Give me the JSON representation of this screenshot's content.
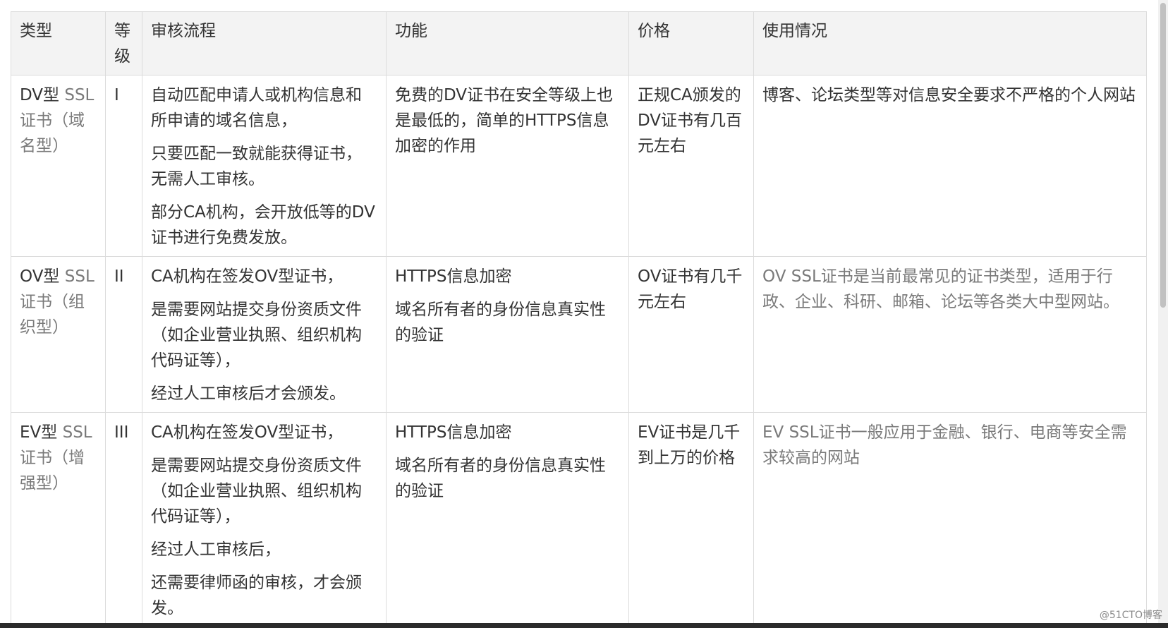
{
  "table": {
    "headers": [
      "类型",
      "等级",
      "审核流程",
      "功能",
      "价格",
      "使用情况"
    ],
    "rows": [
      {
        "type_main": "DV型",
        "type_rest": " SSL证书（域名型）",
        "level": "I",
        "process": [
          "自动匹配申请人或机构信息和所申请的域名信息，",
          "只要匹配一致就能获得证书，无需人工审核。",
          "部分CA机构，会开放低等的DV证书进行免费发放。"
        ],
        "function": [
          "免费的DV证书在安全等级上也是最低的，简单的HTTPS信息加密的作用"
        ],
        "price": "正规CA颁发的DV证书有几百元左右",
        "usage_main": "博客、论坛类型等对信息安全要求不严格的个人网站",
        "usage_rest": ""
      },
      {
        "type_main": "OV型",
        "type_rest": " SSL证书（组织型）",
        "level": "II",
        "process": [
          "CA机构在签发OV型证书，",
          "是需要网站提交身份资质文件（如企业营业执照、组织机构代码证等），",
          "经过人工审核后才会颁发。"
        ],
        "function": [
          "HTTPS信息加密",
          "域名所有者的身份信息真实性的验证"
        ],
        "price": "OV证书有几千元左右",
        "usage_main": "",
        "usage_rest": "OV SSL证书是当前最常见的证书类型，适用于行政、企业、科研、邮箱、论坛等各类大中型网站。"
      },
      {
        "type_main": "EV型",
        "type_rest": " SSL证书（增强型）",
        "level": "III",
        "process": [
          "CA机构在签发OV型证书，",
          "是需要网站提交身份资质文件（如企业营业执照、组织机构代码证等），",
          "经过人工审核后，",
          "还需要律师函的审核，才会颁发。"
        ],
        "function": [
          "HTTPS信息加密",
          "域名所有者的身份信息真实性的验证"
        ],
        "price": "EV证书是几千到上万的价格",
        "usage_main": "",
        "usage_rest": "EV SSL证书一般应用于金融、银行、电商等安全需求较高的网站"
      }
    ]
  },
  "watermark": "@51CTO博客"
}
